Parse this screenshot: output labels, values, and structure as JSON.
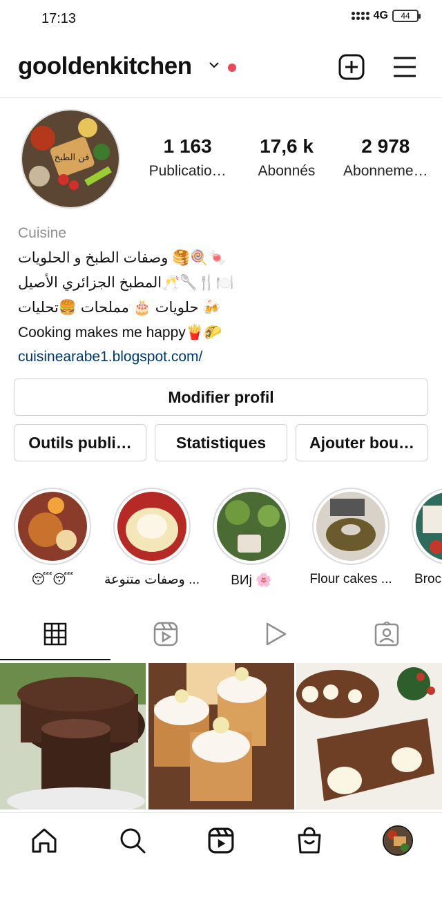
{
  "status_bar": {
    "time": "17:13",
    "network": "4G",
    "battery": "44"
  },
  "header": {
    "username": "gooldenkitchen",
    "icons": [
      "chevron-down-icon",
      "new-post-icon",
      "menu-icon"
    ],
    "notification_dot_color": "#ed4956"
  },
  "profile": {
    "avatar_label": "فن الطبخ",
    "stats": [
      {
        "value": "1 163",
        "label": "Publicatio…"
      },
      {
        "value": "17,6 k",
        "label": "Abonnés"
      },
      {
        "value": "2 978",
        "label": "Abonneme…"
      }
    ]
  },
  "bio": {
    "category": "Cuisine",
    "lines": [
      "🍬🍭🥞 وصفات الطبخ و الحلويات",
      "🍽️🍴🥄🥂المطبخ الجزائري الأصيل",
      "🍻 حلويات 🎂 مملحات 🍔تحليات",
      "Cooking makes me happy🍟🌮"
    ],
    "link": "cuisinearabe1.blogspot.com/",
    "link_color": "#00376b"
  },
  "buttons": {
    "edit_profile": "Modifier profil",
    "tools": "Outils publi…",
    "stats": "Statistiques",
    "add": "Ajouter bou…"
  },
  "highlights": [
    {
      "label": "😴😴"
    },
    {
      "label": "وصفات متنوعة ..."
    },
    {
      "label": "BИj 🌸"
    },
    {
      "label": "Flour cakes ..."
    },
    {
      "label": "Broc"
    }
  ],
  "tabs": [
    "grid-icon",
    "reels-icon",
    "video-icon",
    "tagged-icon"
  ],
  "bottom_nav": [
    "home-icon",
    "search-icon",
    "reels-icon",
    "shop-icon",
    "profile-avatar"
  ]
}
